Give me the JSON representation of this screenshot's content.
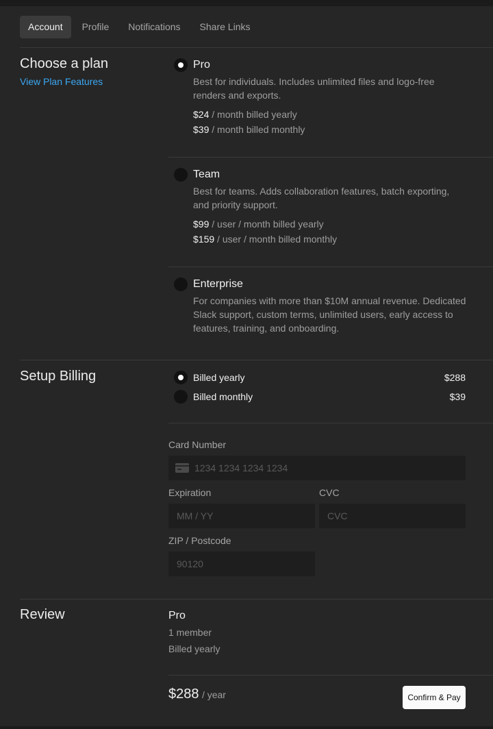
{
  "tabs": [
    {
      "label": "Account",
      "active": true
    },
    {
      "label": "Profile",
      "active": false
    },
    {
      "label": "Notifications",
      "active": false
    },
    {
      "label": "Share Links",
      "active": false
    }
  ],
  "plan_section": {
    "title": "Choose a plan",
    "link": "View Plan Features",
    "plans": [
      {
        "name": "Pro",
        "selected": true,
        "description": "Best for individuals. Includes unlimited files and logo-free renders and exports.",
        "prices": [
          {
            "amount": "$24",
            "suffix": " / month billed yearly"
          },
          {
            "amount": "$39",
            "suffix": " / month billed monthly"
          }
        ]
      },
      {
        "name": "Team",
        "selected": false,
        "description": "Best for teams. Adds collaboration features, batch exporting, and priority support.",
        "prices": [
          {
            "amount": "$99",
            "suffix": " / user / month billed yearly"
          },
          {
            "amount": "$159",
            "suffix": " / user / month billed monthly"
          }
        ]
      },
      {
        "name": "Enterprise",
        "selected": false,
        "description": "For companies with more than $10M annual revenue. Dedicated Slack support, custom terms, unlimited users, early access to features, training, and onboarding."
      }
    ]
  },
  "billing_section": {
    "title": "Setup Billing",
    "options": [
      {
        "label": "Billed yearly",
        "amount": "$288",
        "selected": true
      },
      {
        "label": "Billed monthly",
        "amount": "$39",
        "selected": false
      }
    ],
    "card_number": {
      "label": "Card Number",
      "placeholder": "1234 1234 1234 1234"
    },
    "expiration": {
      "label": "Expiration",
      "placeholder": "MM / YY"
    },
    "cvc": {
      "label": "CVC",
      "placeholder": "CVC"
    },
    "zip": {
      "label": "ZIP / Postcode",
      "placeholder": "90120"
    }
  },
  "review_section": {
    "title": "Review",
    "plan": "Pro",
    "members": "1 member",
    "billing": "Billed yearly",
    "total": "$288",
    "total_unit": "/ year",
    "confirm_label": "Confirm & Pay"
  },
  "icons": {
    "card": "credit-card-icon"
  }
}
